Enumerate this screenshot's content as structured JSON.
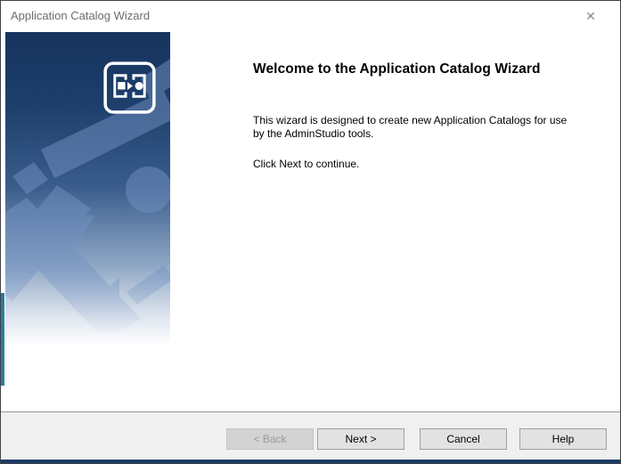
{
  "window": {
    "title": "Application Catalog Wizard"
  },
  "icons": {
    "close": "✕",
    "app_icon_name": "application-catalog-icon"
  },
  "content": {
    "heading": "Welcome to the Application Catalog Wizard",
    "body_paragraph": "This wizard is designed to create new Application Catalogs for use by the AdminStudio tools.",
    "body_instruction": "Click Next to continue."
  },
  "buttons": {
    "back": "< Back",
    "next": "Next >",
    "cancel": "Cancel",
    "help": "Help"
  },
  "colors": {
    "sidebar_navy": "#16345e",
    "shape_blue": "#7292c2",
    "bottom_edge_navy": "#1b3b66",
    "footer_bg": "#f0f0f0",
    "button_bg": "#e2e2e2",
    "disabled_text": "#9a9a9a",
    "title_text": "#6e6e6e",
    "teal_edge": "#2b7e9d"
  }
}
